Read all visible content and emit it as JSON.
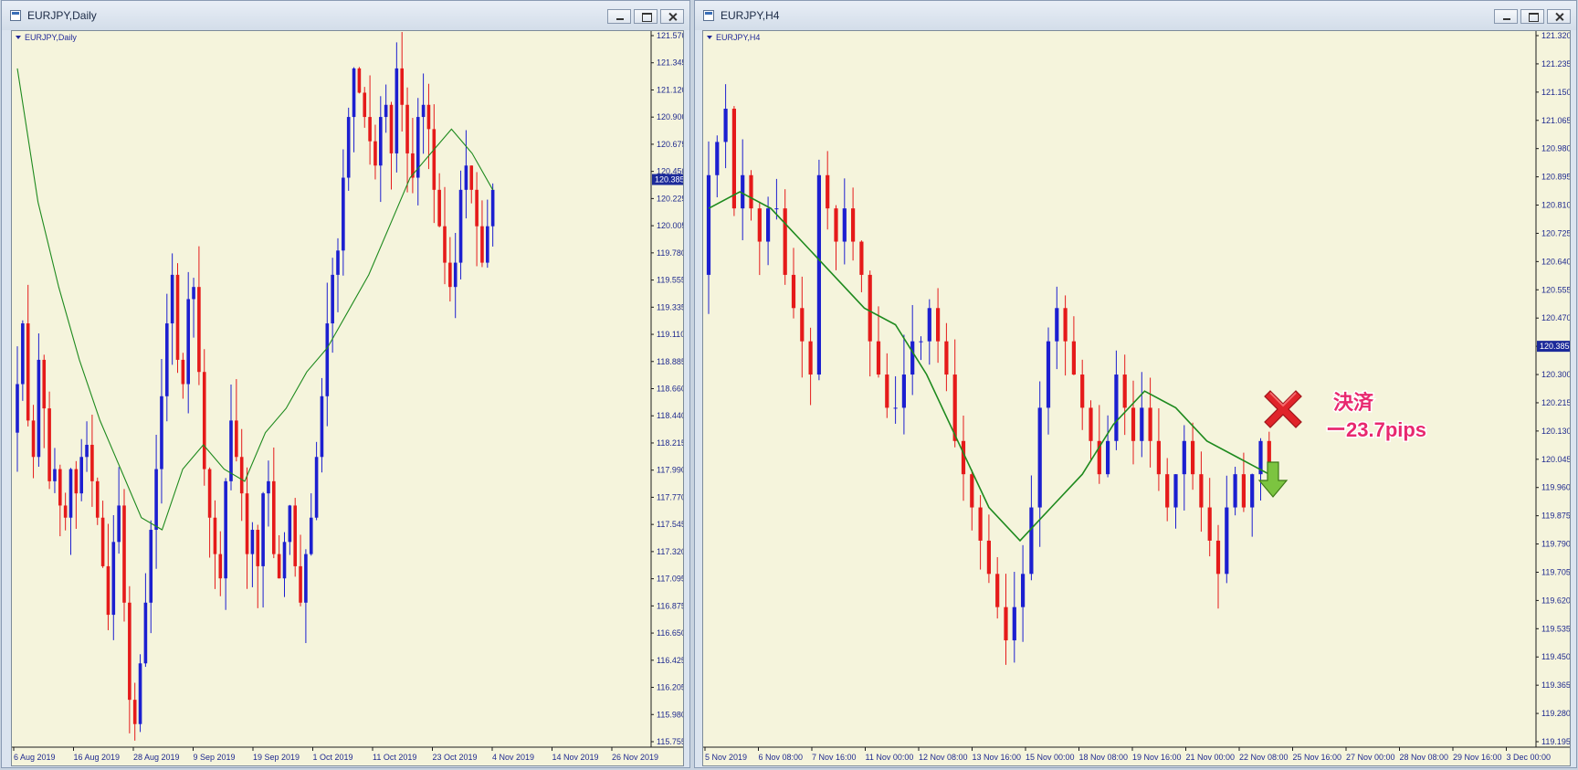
{
  "windows": [
    {
      "title": "EURJPY,Daily",
      "symbol_label": "EURJPY,Daily",
      "price_labels": [
        "121.570",
        "121.345",
        "121.120",
        "120.900",
        "120.675",
        "120.450",
        "120.225",
        "120.005",
        "119.780",
        "119.555",
        "119.335",
        "119.110",
        "118.885",
        "118.660",
        "118.440",
        "118.215",
        "117.990",
        "117.770",
        "117.545",
        "117.320",
        "117.095",
        "116.875",
        "116.650",
        "116.425",
        "116.205",
        "115.980",
        "115.755"
      ],
      "current_price": "120.385",
      "date_labels": [
        "6 Aug 2019",
        "16 Aug 2019",
        "28 Aug 2019",
        "9 Sep 2019",
        "19 Sep 2019",
        "1 Oct 2019",
        "11 Oct 2019",
        "23 Oct 2019",
        "4 Nov 2019",
        "14 Nov 2019",
        "26 Nov 2019"
      ]
    },
    {
      "title": "EURJPY,H4",
      "symbol_label": "EURJPY,H4",
      "price_labels": [
        "121.320",
        "121.235",
        "121.150",
        "121.065",
        "120.980",
        "120.895",
        "120.810",
        "120.725",
        "120.640",
        "120.555",
        "120.470",
        "120.385",
        "120.300",
        "120.215",
        "120.130",
        "120.045",
        "119.960",
        "119.875",
        "119.790",
        "119.705",
        "119.620",
        "119.535",
        "119.450",
        "119.365",
        "119.280",
        "119.195"
      ],
      "current_price": "120.385",
      "date_labels": [
        "5 Nov 2019",
        "6 Nov 08:00",
        "7 Nov 16:00",
        "11 Nov 00:00",
        "12 Nov 08:00",
        "13 Nov 16:00",
        "15 Nov 00:00",
        "18 Nov 08:00",
        "19 Nov 16:00",
        "21 Nov 00:00",
        "22 Nov 08:00",
        "25 Nov 16:00",
        "27 Nov 00:00",
        "28 Nov 08:00",
        "29 Nov 16:00",
        "3 Dec 00:00"
      ],
      "annotation": {
        "line1": "決済",
        "line2": "ー23.7pips"
      }
    }
  ],
  "colors": {
    "bull": "#1c1fd0",
    "bear": "#e51a1a",
    "ma": "#1e8a1e",
    "chart_bg": "#f5f4dc",
    "axis_text": "#1f2a8f",
    "badge_bg": "#1c2a9a",
    "annotation": "#e8286f"
  },
  "icons": {
    "window": "chart-window-icon",
    "exit": "red-x-icon",
    "entry": "green-down-arrow-icon"
  },
  "chart_data": [
    {
      "type": "candlestick",
      "title": "EURJPY,Daily",
      "ylim": [
        115.755,
        121.57
      ],
      "x_tick_labels": [
        "6 Aug 2019",
        "16 Aug 2019",
        "28 Aug 2019",
        "9 Sep 2019",
        "19 Sep 2019",
        "1 Oct 2019",
        "11 Oct 2019",
        "23 Oct 2019",
        "4 Nov 2019",
        "14 Nov 2019",
        "26 Nov 2019"
      ],
      "y_tick_labels": [
        "121.570",
        "121.345",
        "121.120",
        "120.900",
        "120.675",
        "120.450",
        "120.225",
        "120.005",
        "119.780",
        "119.555",
        "119.335",
        "119.110",
        "118.885",
        "118.660",
        "118.440",
        "118.215",
        "117.990",
        "117.770",
        "117.545",
        "117.320",
        "117.095",
        "116.875",
        "116.650",
        "116.425",
        "116.205",
        "115.980",
        "115.755"
      ],
      "current_price": 120.385,
      "close": [
        118.7,
        119.2,
        118.4,
        118.1,
        118.9,
        118.5,
        117.9,
        118.0,
        117.7,
        117.6,
        118.0,
        117.8,
        118.1,
        118.2,
        117.9,
        117.6,
        117.2,
        116.8,
        117.4,
        117.7,
        116.9,
        116.1,
        115.9,
        116.4,
        116.9,
        117.5,
        118.0,
        118.6,
        119.2,
        119.6,
        118.9,
        118.7,
        119.4,
        119.5,
        118.8,
        118.0,
        117.6,
        117.3,
        117.1,
        117.9,
        118.4,
        118.1,
        117.8,
        117.3,
        117.5,
        117.2,
        117.8,
        117.9,
        117.3,
        117.1,
        117.4,
        117.7,
        117.2,
        116.9,
        117.3,
        117.6,
        118.1,
        118.6,
        119.2,
        119.6,
        119.8,
        120.4,
        120.9,
        121.3,
        121.1,
        120.9,
        120.7,
        120.5,
        120.9,
        121.0,
        120.6,
        121.3,
        121.0,
        120.6,
        120.4,
        120.9,
        121.0,
        120.8,
        120.3,
        120.0,
        119.7,
        119.5,
        119.7,
        120.3,
        120.5,
        120.3,
        120.0,
        119.7,
        120.0,
        120.3
      ],
      "moving_average": [
        121.3,
        120.2,
        119.5,
        118.9,
        118.4,
        118.0,
        117.6,
        117.5,
        118.0,
        118.2,
        118.0,
        117.9,
        118.3,
        118.5,
        118.8,
        119.0,
        119.3,
        119.6,
        120.0,
        120.4,
        120.6,
        120.8,
        120.6,
        120.3
      ]
    },
    {
      "type": "candlestick",
      "title": "EURJPY,H4",
      "ylim": [
        119.195,
        121.32
      ],
      "x_tick_labels": [
        "5 Nov 2019",
        "6 Nov 08:00",
        "7 Nov 16:00",
        "11 Nov 00:00",
        "12 Nov 08:00",
        "13 Nov 16:00",
        "15 Nov 00:00",
        "18 Nov 08:00",
        "19 Nov 16:00",
        "21 Nov 00:00",
        "22 Nov 08:00",
        "25 Nov 16:00",
        "27 Nov 00:00",
        "28 Nov 08:00",
        "29 Nov 16:00",
        "3 Dec 00:00"
      ],
      "y_tick_labels": [
        "121.320",
        "121.235",
        "121.150",
        "121.065",
        "120.980",
        "120.895",
        "120.810",
        "120.725",
        "120.640",
        "120.555",
        "120.470",
        "120.385",
        "120.300",
        "120.215",
        "120.130",
        "120.045",
        "119.960",
        "119.875",
        "119.790",
        "119.705",
        "119.620",
        "119.535",
        "119.450",
        "119.365",
        "119.280",
        "119.195"
      ],
      "current_price": 120.385,
      "close": [
        120.9,
        121.0,
        121.1,
        120.8,
        120.9,
        120.8,
        120.7,
        120.8,
        120.8,
        120.6,
        120.5,
        120.4,
        120.3,
        120.9,
        120.8,
        120.7,
        120.8,
        120.7,
        120.6,
        120.4,
        120.3,
        120.2,
        120.2,
        120.3,
        120.4,
        120.4,
        120.5,
        120.4,
        120.3,
        120.1,
        120.0,
        119.9,
        119.8,
        119.7,
        119.6,
        119.5,
        119.6,
        119.7,
        119.9,
        120.2,
        120.4,
        120.5,
        120.4,
        120.3,
        120.2,
        120.1,
        120.0,
        120.1,
        120.3,
        120.2,
        120.1,
        120.2,
        120.1,
        120.0,
        119.9,
        120.0,
        120.1,
        120.0,
        119.9,
        119.8,
        119.7,
        119.9,
        120.0,
        119.9,
        120.0,
        120.1,
        120.0
      ],
      "moving_average": [
        120.8,
        120.85,
        120.8,
        120.7,
        120.6,
        120.5,
        120.45,
        120.3,
        120.1,
        119.9,
        119.8,
        119.9,
        120.0,
        120.15,
        120.25,
        120.2,
        120.1,
        120.05,
        120.0
      ],
      "annotations": [
        {
          "kind": "exit",
          "text": "決済 ー23.7pips"
        },
        {
          "kind": "entry",
          "direction": "sell"
        }
      ]
    }
  ]
}
